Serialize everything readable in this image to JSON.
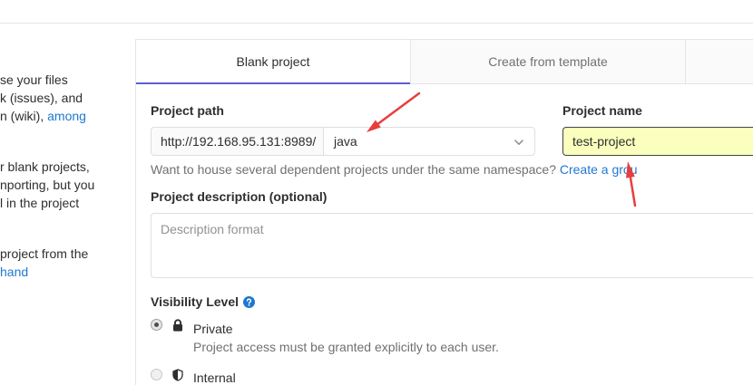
{
  "colors": {
    "link": "#1f78d1",
    "tab_active_underline": "#5d5fd0",
    "autofill_background": "#faffbd",
    "annotation_arrow": "#e83e3e"
  },
  "intro": {
    "paragraph1": {
      "line1": "se your files",
      "line2": "k (issues), and",
      "line3_text": "n (wiki), ",
      "line3_link": "among"
    },
    "paragraph2": {
      "line1": "r blank projects,",
      "line2": "nporting, but you",
      "line3": "l in the project"
    },
    "paragraph3": {
      "line1": "project from the",
      "line2_link": "hand"
    }
  },
  "tabs": [
    {
      "label": "Blank project",
      "active": true
    },
    {
      "label": "Create from template",
      "active": false
    },
    {
      "active": false
    }
  ],
  "form": {
    "project_path": {
      "label": "Project path",
      "url_prefix": "http://192.168.95.131:8989/",
      "namespace_selected": "java",
      "dropdown_icon": "chevron-down-icon"
    },
    "project_name": {
      "label": "Project name",
      "value": "test-project"
    },
    "namespace_help": {
      "text": "Want to house several dependent projects under the same namespace? ",
      "link": "Create a grou"
    },
    "description": {
      "label": "Project description (optional)",
      "placeholder": "Description format"
    },
    "visibility": {
      "label": "Visibility Level",
      "help_icon": "question-circle-icon",
      "options": [
        {
          "label": "Private",
          "description": "Project access must be granted explicitly to each user.",
          "icon": "lock-icon",
          "selected": true
        },
        {
          "label": "Internal",
          "icon": "shield-icon",
          "selected": false
        }
      ]
    }
  }
}
